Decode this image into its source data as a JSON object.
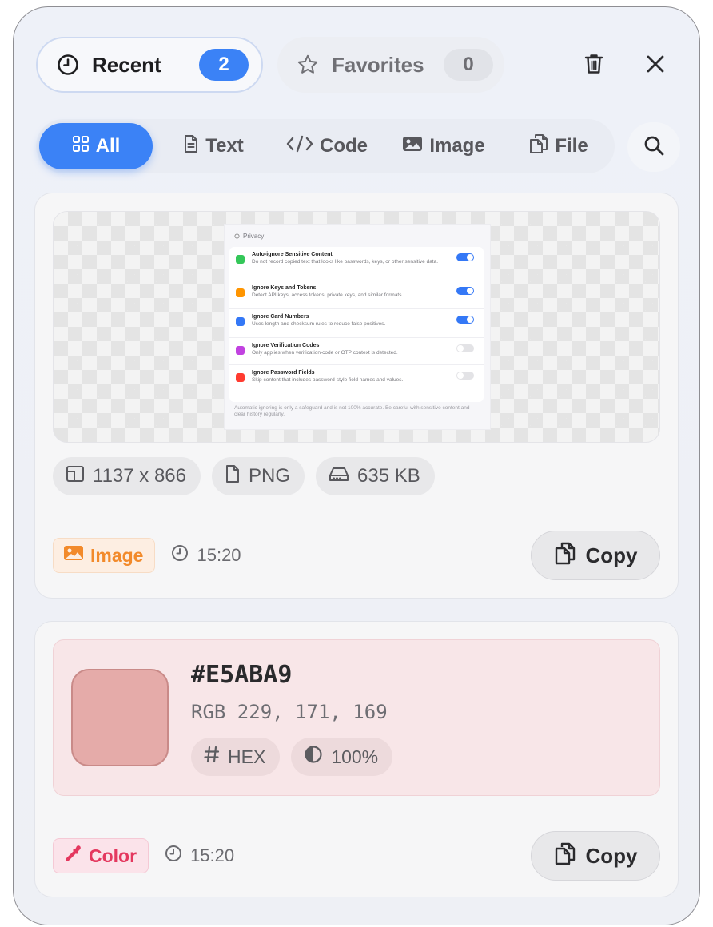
{
  "header": {
    "recent_tab": {
      "label": "Recent",
      "count": "2",
      "icon": "clock-icon"
    },
    "favorites_tab": {
      "label": "Favorites",
      "count": "0",
      "icon": "star-icon"
    },
    "trash_icon": "trash-icon",
    "close_icon": "close-icon"
  },
  "filters": {
    "all": "All",
    "text": "Text",
    "code": "Code",
    "image": "Image",
    "file": "File",
    "search_icon": "search-icon"
  },
  "colors": {
    "accent": "#3b82f6",
    "image_badge": "#f28a2b",
    "color_badge": "#e4385f"
  },
  "items": [
    {
      "kind": "image",
      "preview": {
        "title": "Privacy",
        "rows": [
          {
            "title": "Auto-ignore Sensitive Content",
            "desc": "Do not record copied text that looks like passwords, keys, or other sensitive data.",
            "icon_color": "#34c759",
            "enabled": true
          },
          {
            "title": "Ignore Keys and Tokens",
            "desc": "Detect API keys, access tokens, private keys, and similar formats.",
            "icon_color": "#ff9500",
            "enabled": true
          },
          {
            "title": "Ignore Card Numbers",
            "desc": "Uses length and checksum rules to reduce false positives.",
            "icon_color": "#3478f6",
            "enabled": true
          },
          {
            "title": "Ignore Verification Codes",
            "desc": "Only applies when verification-code or OTP context is detected.",
            "icon_color": "#c142e0",
            "enabled": false
          },
          {
            "title": "Ignore Password Fields",
            "desc": "Skip content that includes password-style field names and values.",
            "icon_color": "#ff3b30",
            "enabled": false
          }
        ],
        "footer": "Automatic ignoring is only a safeguard and is not 100% accurate. Be careful with sensitive content and clear history regularly."
      },
      "dimensions": "1137 x 866",
      "format": "PNG",
      "size": "635 KB",
      "type_label": "Image",
      "time": "15:20",
      "copy_label": "Copy"
    },
    {
      "kind": "color",
      "hex": "#E5ABA9",
      "rgb": "RGB 229, 171, 169",
      "swatch_color": "#E5ABA9",
      "format_chip": "HEX",
      "opacity_chip": "100%",
      "type_label": "Color",
      "time": "15:20",
      "copy_label": "Copy"
    }
  ]
}
